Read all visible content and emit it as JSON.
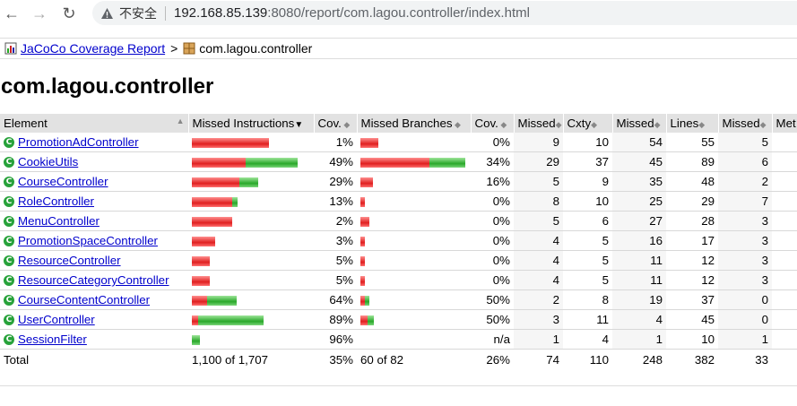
{
  "browser": {
    "insecure_label": "不安全",
    "url_host": "192.168.85.139",
    "url_rest": ":8080/report/com.lagou.controller/index.html"
  },
  "breadcrumb": {
    "root": "JaCoCo Coverage Report",
    "separator": ">",
    "current": "com.lagou.controller"
  },
  "page_title": "com.lagou.controller",
  "table": {
    "headers": [
      "Element",
      "Missed Instructions",
      "Cov.",
      "Missed Branches",
      "Cov.",
      "Missed",
      "Cxty",
      "Missed",
      "Lines",
      "Missed",
      "Met"
    ],
    "rows": [
      {
        "name": "PromotionAdController",
        "ins_missed_frac": 1.0,
        "ins_cov_frac": 0.0,
        "ins_cov": "1%",
        "br_missed_frac": 0.17,
        "br_cov_frac": 0.0,
        "br_cov": "0%",
        "cx_missed": "9",
        "cxty": "10",
        "ln_missed": "54",
        "lines": "55",
        "mt_missed": "5"
      },
      {
        "name": "CookieUtils",
        "ins_missed_frac": 0.7,
        "ins_cov_frac": 0.68,
        "ins_cov": "49%",
        "br_missed_frac": 0.65,
        "br_cov_frac": 0.34,
        "br_cov": "34%",
        "cx_missed": "29",
        "cxty": "37",
        "ln_missed": "45",
        "lines": "89",
        "mt_missed": "6"
      },
      {
        "name": "CourseController",
        "ins_missed_frac": 0.62,
        "ins_cov_frac": 0.25,
        "ins_cov": "29%",
        "br_missed_frac": 0.12,
        "br_cov_frac": 0.0,
        "br_cov": "16%",
        "cx_missed": "5",
        "cxty": "9",
        "ln_missed": "35",
        "lines": "48",
        "mt_missed": "2"
      },
      {
        "name": "RoleController",
        "ins_missed_frac": 0.52,
        "ins_cov_frac": 0.07,
        "ins_cov": "13%",
        "br_missed_frac": 0.04,
        "br_cov_frac": 0.0,
        "br_cov": "0%",
        "cx_missed": "8",
        "cxty": "10",
        "ln_missed": "25",
        "lines": "29",
        "mt_missed": "7"
      },
      {
        "name": "MenuController",
        "ins_missed_frac": 0.52,
        "ins_cov_frac": 0.0,
        "ins_cov": "2%",
        "br_missed_frac": 0.08,
        "br_cov_frac": 0.0,
        "br_cov": "0%",
        "cx_missed": "5",
        "cxty": "6",
        "ln_missed": "27",
        "lines": "28",
        "mt_missed": "3"
      },
      {
        "name": "PromotionSpaceController",
        "ins_missed_frac": 0.3,
        "ins_cov_frac": 0.0,
        "ins_cov": "3%",
        "br_missed_frac": 0.04,
        "br_cov_frac": 0.0,
        "br_cov": "0%",
        "cx_missed": "4",
        "cxty": "5",
        "ln_missed": "16",
        "lines": "17",
        "mt_missed": "3"
      },
      {
        "name": "ResourceController",
        "ins_missed_frac": 0.23,
        "ins_cov_frac": 0.0,
        "ins_cov": "5%",
        "br_missed_frac": 0.04,
        "br_cov_frac": 0.0,
        "br_cov": "0%",
        "cx_missed": "4",
        "cxty": "5",
        "ln_missed": "11",
        "lines": "12",
        "mt_missed": "3"
      },
      {
        "name": "ResourceCategoryController",
        "ins_missed_frac": 0.23,
        "ins_cov_frac": 0.0,
        "ins_cov": "5%",
        "br_missed_frac": 0.04,
        "br_cov_frac": 0.0,
        "br_cov": "0%",
        "cx_missed": "4",
        "cxty": "5",
        "ln_missed": "11",
        "lines": "12",
        "mt_missed": "3"
      },
      {
        "name": "CourseContentController",
        "ins_missed_frac": 0.2,
        "ins_cov_frac": 0.38,
        "ins_cov": "64%",
        "br_missed_frac": 0.04,
        "br_cov_frac": 0.04,
        "br_cov": "50%",
        "cx_missed": "2",
        "cxty": "8",
        "ln_missed": "19",
        "lines": "37",
        "mt_missed": "0"
      },
      {
        "name": "UserController",
        "ins_missed_frac": 0.08,
        "ins_cov_frac": 0.85,
        "ins_cov": "89%",
        "br_missed_frac": 0.07,
        "br_cov_frac": 0.06,
        "br_cov": "50%",
        "cx_missed": "3",
        "cxty": "11",
        "ln_missed": "4",
        "lines": "45",
        "mt_missed": "0"
      },
      {
        "name": "SessionFilter",
        "ins_missed_frac": 0.0,
        "ins_cov_frac": 0.1,
        "ins_cov": "96%",
        "br_missed_frac": 0.0,
        "br_cov_frac": 0.0,
        "br_cov": "n/a",
        "cx_missed": "1",
        "cxty": "4",
        "ln_missed": "1",
        "lines": "10",
        "mt_missed": "1"
      }
    ],
    "total": {
      "label": "Total",
      "ins": "1,100 of 1,707",
      "ins_cov": "35%",
      "br": "60 of 82",
      "br_cov": "26%",
      "cx_missed": "74",
      "cxty": "110",
      "ln_missed": "248",
      "lines": "382",
      "mt_missed": "33"
    }
  }
}
